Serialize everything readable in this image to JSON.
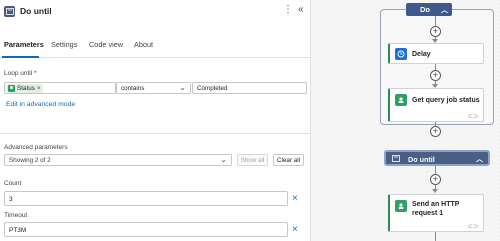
{
  "panel": {
    "title": "Do until",
    "more_label": "⋮",
    "collapse_label": "«",
    "tabs": [
      {
        "label": "Parameters",
        "active": true
      },
      {
        "label": "Settings",
        "active": false
      },
      {
        "label": "Code view",
        "active": false
      },
      {
        "label": "About",
        "active": false
      }
    ],
    "loop_until": {
      "label": "Loop until *",
      "token": "Status",
      "token_remove": "×",
      "operator": "contains",
      "value": "Completed"
    },
    "advanced_link": "Edit in advanced mode",
    "advanced_parameters": {
      "label": "Advanced parameters",
      "selected": "Showing 2 of 2",
      "show_all": "Show all",
      "clear_all": "Clear all"
    },
    "count": {
      "label": "Count",
      "value": "3"
    },
    "timeout": {
      "label": "Timeout",
      "value": "PT3M"
    },
    "remove_glyph": "×"
  },
  "canvas": {
    "scope_tag": "Do",
    "plus_glyph": "+",
    "cards": [
      {
        "title": "Delay",
        "icon": "clock-icon",
        "color": "#1f6fd6"
      },
      {
        "title": "Get query job status",
        "icon": "connector-icon",
        "color": "#2ea066"
      },
      {
        "title": "Send an HTTP request 1",
        "icon": "connector-icon",
        "color": "#2ea066"
      }
    ],
    "do_until": "Do until",
    "card_accent": "#2e8b57",
    "scope_color": "#3f5a8a"
  }
}
